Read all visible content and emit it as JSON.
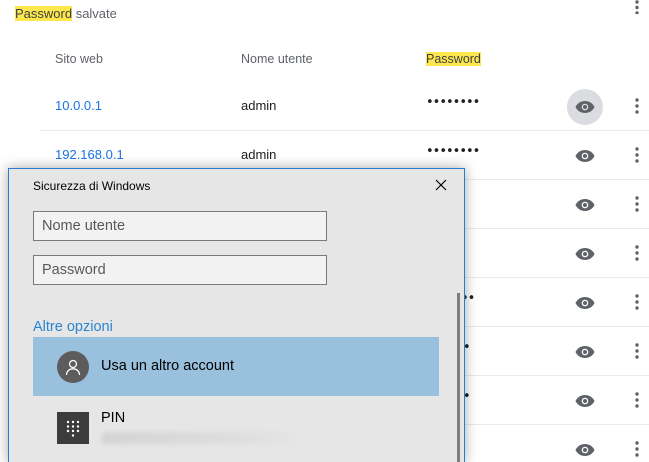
{
  "page": {
    "section_title_highlight": "Password",
    "section_title_rest": " salvate",
    "columns": {
      "site": "Sito web",
      "user": "Nome utente",
      "password": "Password"
    },
    "rows": [
      {
        "site": "10.0.0.1",
        "user": "admin",
        "password": "••••••••"
      },
      {
        "site": "192.168.0.1",
        "user": "admin",
        "password": "••••••••"
      },
      {
        "site": "",
        "user": "",
        "password": ""
      },
      {
        "site": "",
        "user": "",
        "password": ""
      },
      {
        "site": "",
        "user": "",
        "password": "••"
      },
      {
        "site": "",
        "user": "",
        "password": "•"
      },
      {
        "site": "",
        "user": "",
        "password": "•"
      },
      {
        "site": "",
        "user": "",
        "password": ""
      }
    ],
    "icons": {
      "show_password": "eye-icon",
      "row_menu": "more-vertical-icon"
    }
  },
  "dialog": {
    "title": "Sicurezza di Windows",
    "username_placeholder": "Nome utente",
    "password_placeholder": "Password",
    "more_options": "Altre opzioni",
    "options": [
      {
        "label": "Usa un altro account",
        "icon": "user-avatar-icon",
        "selected": true
      },
      {
        "label": "PIN",
        "icon": "pin-keypad-icon",
        "selected": false
      }
    ]
  },
  "colors": {
    "highlight": "#fde74c",
    "link": "#1a73e8",
    "dialog_accent": "#2b84d0",
    "selected_option": "#99c0dc"
  }
}
